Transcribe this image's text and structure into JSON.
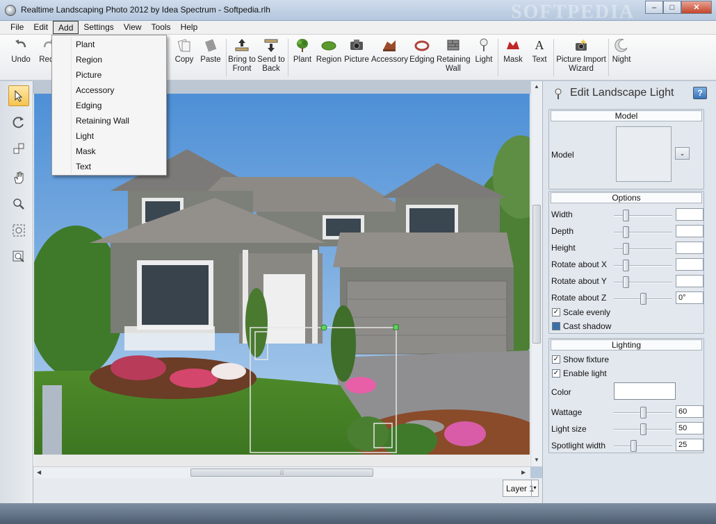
{
  "window": {
    "title": "Realtime Landscaping Photo 2012 by Idea Spectrum - Softpedia.rlh",
    "watermark": "SOFTPEDIA",
    "btn_minimize": "–",
    "btn_maximize": "□",
    "btn_close": "✕"
  },
  "menubar": {
    "items": [
      "File",
      "Edit",
      "Add",
      "Settings",
      "View",
      "Tools",
      "Help"
    ],
    "active": "Add"
  },
  "add_menu": {
    "items": [
      "Plant",
      "Region",
      "Picture",
      "Accessory",
      "Edging",
      "Retaining Wall",
      "Light",
      "Mask",
      "Text"
    ]
  },
  "toolbar": {
    "undo": "Undo",
    "redo": "Redo",
    "copy": "Copy",
    "paste": "Paste",
    "bring_to_front": [
      "Bring to",
      "Front"
    ],
    "send_to_back": [
      "Send to",
      "Back"
    ],
    "plant": "Plant",
    "region": "Region",
    "picture": "Picture",
    "accessory": "Accessory",
    "edging": "Edging",
    "retaining_wall": [
      "Retaining",
      "Wall"
    ],
    "light": "Light",
    "mask": "Mask",
    "text": "Text",
    "picture_import_wizard": [
      "Picture Import",
      "Wizard"
    ],
    "night": "Night"
  },
  "layer": {
    "label": "Layer 1"
  },
  "panel": {
    "title": "Edit Landscape Light",
    "help": "?",
    "model_section": "Model",
    "model_label": "Model",
    "options_section": "Options",
    "options": [
      {
        "label": "Width",
        "value": "",
        "level": 0.2
      },
      {
        "label": "Depth",
        "value": "",
        "level": 0.2
      },
      {
        "label": "Height",
        "value": "",
        "level": 0.2
      },
      {
        "label": "Rotate about X",
        "value": "",
        "level": 0.2
      },
      {
        "label": "Rotate about Y",
        "value": "",
        "level": 0.2
      },
      {
        "label": "Rotate about Z",
        "value": "0°",
        "level": 0.5
      }
    ],
    "scale_evenly": {
      "label": "Scale evenly",
      "checked": true
    },
    "cast_shadow": {
      "label": "Cast shadow",
      "checked": false
    },
    "lighting_section": "Lighting",
    "show_fixture": {
      "label": "Show fixture",
      "checked": true
    },
    "enable_light": {
      "label": "Enable light",
      "checked": true
    },
    "color_label": "Color",
    "wattage": {
      "label": "Wattage",
      "value": "60",
      "level": 0.5
    },
    "light_size": {
      "label": "Light size",
      "value": "50",
      "level": 0.5
    },
    "spotlight_width": {
      "label": "Spotlight width",
      "value": "25",
      "level": 0.33
    }
  },
  "colors": {
    "accent": "#f6c34f",
    "title_bar": "#b5c7dd",
    "panel_bg": "#dfe5ec"
  }
}
